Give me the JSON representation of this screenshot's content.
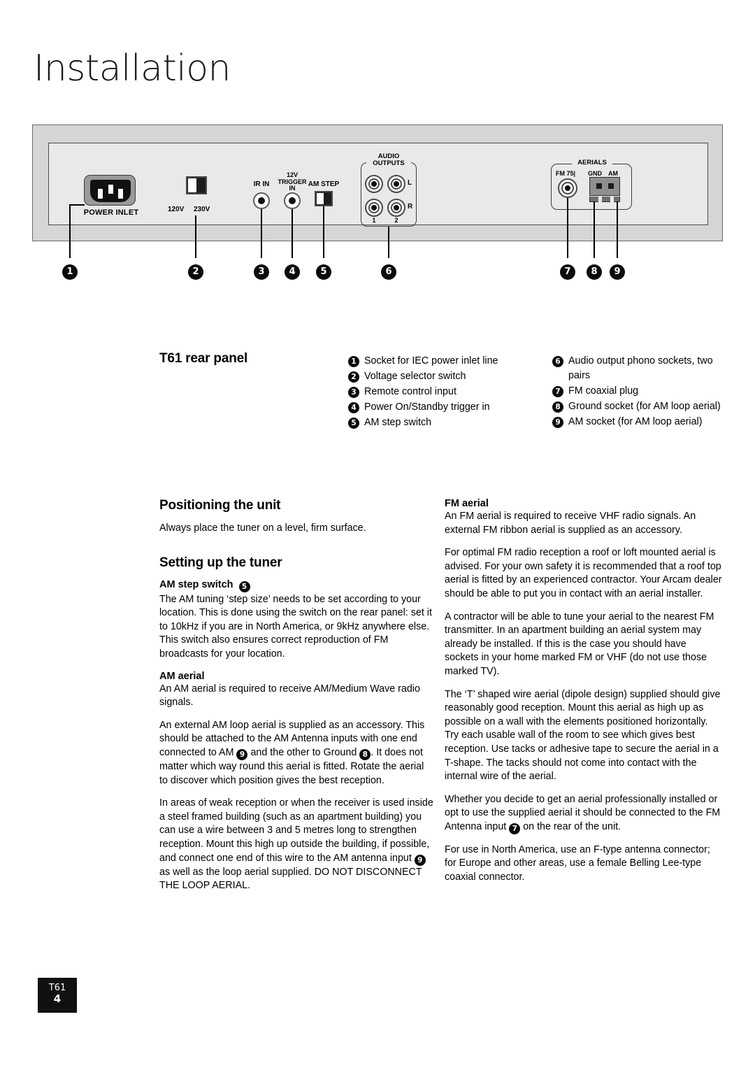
{
  "page": {
    "title": "Installation"
  },
  "diagram": {
    "power_inlet_label": "POWER INLET",
    "voltage_120": "120V",
    "voltage_230": "230V",
    "ir_in_label": "IR IN",
    "trigger_label": "12V\nTRIGGER\nIN",
    "trigger_line1": "12V",
    "trigger_line2": "TRIGGER",
    "trigger_line3": "IN",
    "am_step_label": "AM STEP",
    "audio_outputs_line1": "AUDIO",
    "audio_outputs_line2": "OUTPUTS",
    "audio_L": "L",
    "audio_R": "R",
    "audio_1": "1",
    "audio_2": "2",
    "aerials_label": "AERIALS",
    "fm75_label": "FM 75|",
    "gnd_label": "GND",
    "am_label": "AM",
    "callouts": [
      "1",
      "2",
      "3",
      "4",
      "5",
      "6",
      "7",
      "8",
      "9"
    ]
  },
  "rear_panel": {
    "heading": "T61 rear panel",
    "legend_col1": [
      {
        "num": "1",
        "text": "Socket for IEC power inlet line"
      },
      {
        "num": "2",
        "text": "Voltage selector switch"
      },
      {
        "num": "3",
        "text": "Remote control input"
      },
      {
        "num": "4",
        "text": "Power On/Standby trigger in"
      },
      {
        "num": "5",
        "text": "AM step switch"
      }
    ],
    "legend_col2": [
      {
        "num": "6",
        "text": "Audio output phono sockets, two pairs"
      },
      {
        "num": "7",
        "text": "FM coaxial plug"
      },
      {
        "num": "8",
        "text": "Ground socket (for AM loop aerial)"
      },
      {
        "num": "9",
        "text": "AM socket (for AM loop aerial)"
      }
    ]
  },
  "positioning": {
    "heading": "Positioning the unit",
    "body": "Always place the tuner on a level, firm surface."
  },
  "setting_up": {
    "heading": "Setting up the tuner",
    "am_step_switch": {
      "heading": "AM step switch",
      "badge": "5",
      "body": "The AM tuning ‘step size’ needs to be set according to your location. This is done using the switch on the rear panel: set it to 10kHz if you are in North America, or 9kHz anywhere else. This switch also ensures correct reproduction of FM broadcasts for your location."
    },
    "am_aerial": {
      "heading": "AM aerial",
      "p1": "An AM aerial is required to receive AM/Medium Wave radio signals.",
      "p2_a": "An external AM loop aerial is supplied as an accessory. This should be attached to the AM Antenna inputs with one end connected to AM ",
      "p2_badge1": "9",
      "p2_b": " and the other to Ground ",
      "p2_badge2": "8",
      "p2_c": ". It does not matter which way round this aerial is fitted. Rotate the aerial to discover which position gives the best reception.",
      "p3_a": "In areas of weak reception or when the receiver is used inside a steel framed building (such as an apartment building) you can use a wire between 3 and 5 metres long to strengthen reception. Mount this high up outside the building, if possible, and connect one end of this wire to the AM antenna input ",
      "p3_badge": "9",
      "p3_b": " as well as the loop aerial supplied. DO NOT DISCONNECT THE LOOP AERIAL."
    }
  },
  "fm_aerial": {
    "heading": "FM aerial",
    "p1": "An FM aerial is required to receive VHF radio signals. An external FM ribbon aerial is supplied as an accessory.",
    "p2": "For optimal FM radio reception a roof or loft mounted aerial is advised. For your own safety it is recommended that a roof top aerial is fitted by an experienced contractor. Your Arcam dealer should be able to put you in contact with an aerial installer.",
    "p3": "A contractor will be able to tune your aerial to the nearest FM transmitter. In an apartment building an aerial system may already be installed. If this is the case you should have sockets in your home marked FM or VHF (do not use those marked TV).",
    "p4": "The ‘T’ shaped wire aerial (dipole design) supplied should give reasonably good reception. Mount this aerial as high up as possible on a wall with the elements positioned horizontally. Try each usable wall of the room to see which gives best reception. Use tacks or adhesive tape to secure the aerial in a T-shape. The tacks should not come into contact with the internal wire of the aerial.",
    "p5_a": "Whether you decide to get an aerial professionally installed or opt to use the supplied aerial it should be connected to the FM Antenna input ",
    "p5_badge": "7",
    "p5_b": " on the rear of the unit.",
    "p6": "For use in North America, use an F-type antenna connector; for Europe and other areas, use a female Belling Lee-type coaxial connector."
  },
  "footer": {
    "model": "T61",
    "page": "4"
  }
}
